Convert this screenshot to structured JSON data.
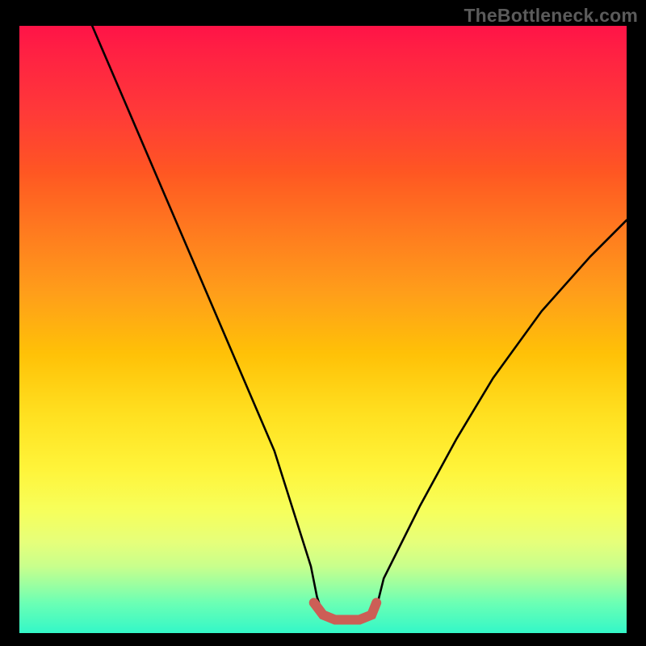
{
  "watermark": {
    "text": "TheBottleneck.com"
  },
  "colors": {
    "frame_bg": "#000000",
    "curve_black": "#000000",
    "curve_highlight": "#cc5e56",
    "gradient_top": "#ff1744",
    "gradient_bottom": "#33f7c8"
  },
  "chart_data": {
    "type": "line",
    "title": "",
    "xlabel": "",
    "ylabel": "",
    "xlim": [
      0,
      100
    ],
    "ylim": [
      0,
      100
    ],
    "grid": false,
    "legend": false,
    "description": "V-shaped bottleneck curve over vertical color gradient background (red at top → yellow → green at bottom). Flat minimum near the bottom is highlighted with a thick salmon segment.",
    "series": [
      {
        "name": "curve",
        "color": "#000000",
        "x": [
          12,
          18,
          24,
          30,
          36,
          42,
          48,
          49,
          50,
          52,
          54,
          56,
          58,
          59,
          60,
          66,
          72,
          78,
          86,
          94,
          100
        ],
        "y": [
          100,
          86,
          72,
          58,
          44,
          30,
          11,
          6,
          3,
          2,
          2,
          2,
          3,
          5,
          9,
          21,
          32,
          42,
          53,
          62,
          68
        ]
      },
      {
        "name": "low-span-highlight",
        "color": "#cc5e56",
        "x": [
          48.5,
          50,
          52,
          54,
          56,
          58,
          58.8
        ],
        "y": [
          5,
          3,
          2.2,
          2.2,
          2.2,
          3,
          5
        ]
      }
    ]
  }
}
